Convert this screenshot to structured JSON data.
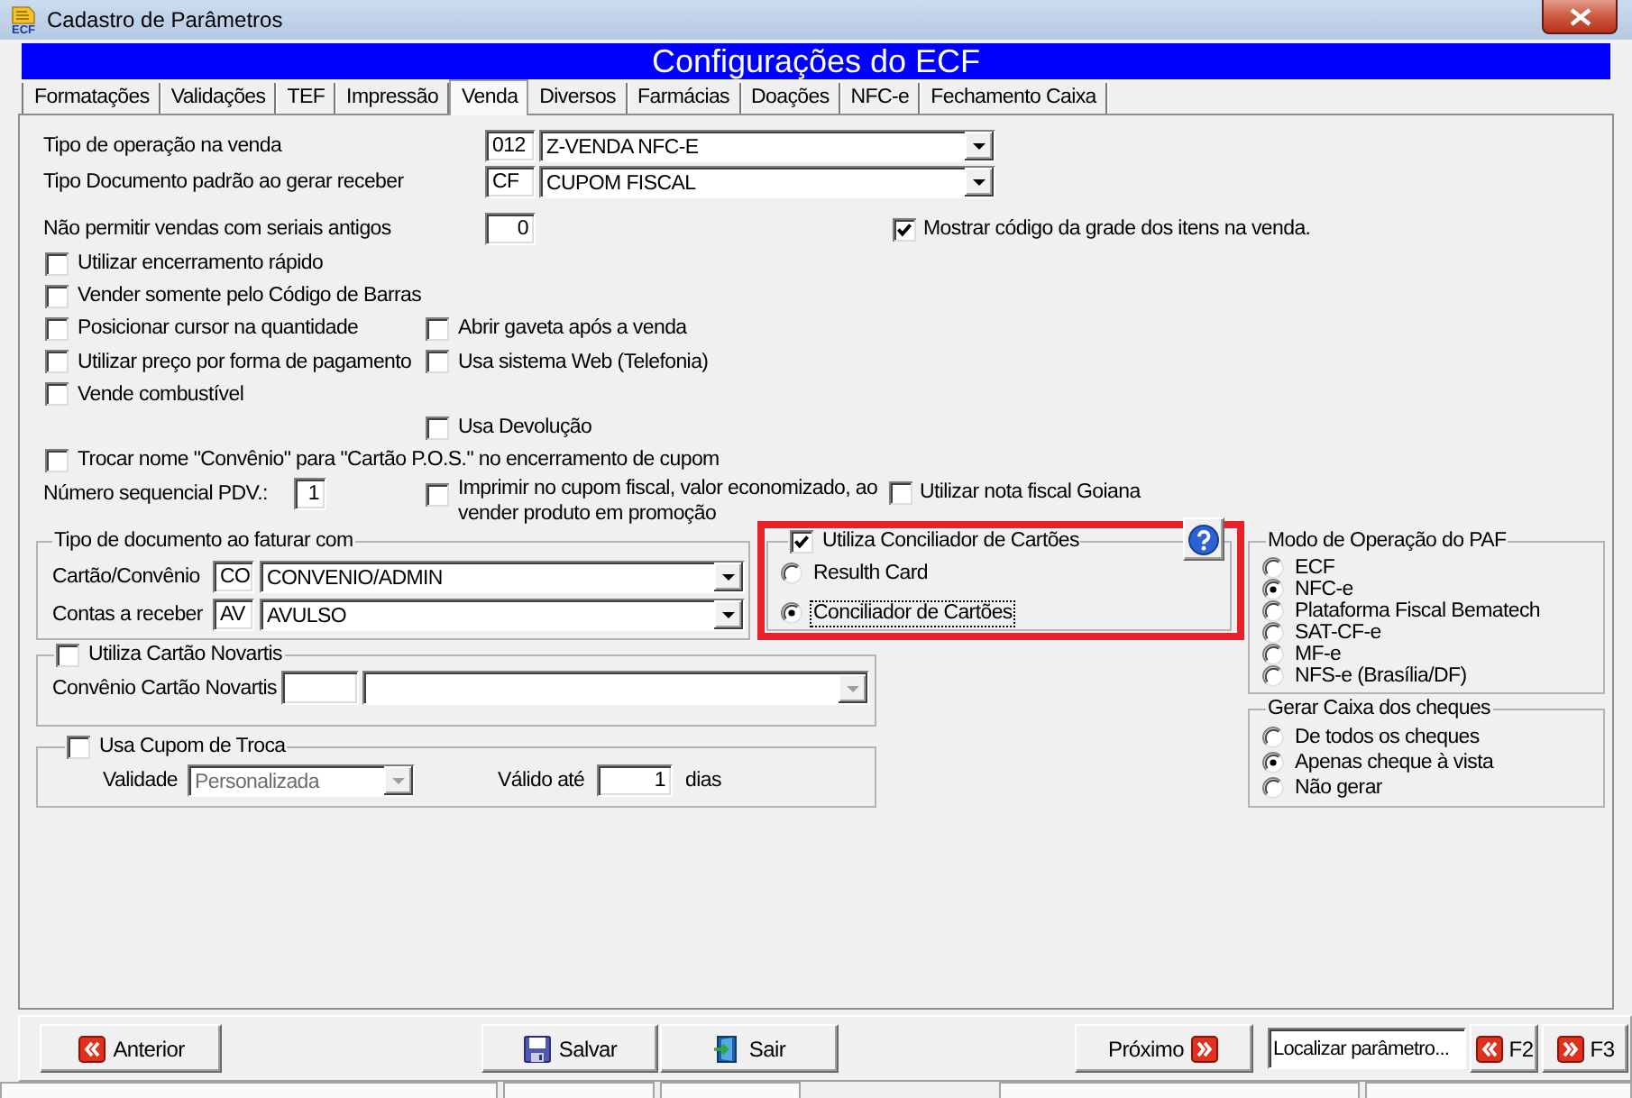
{
  "window": {
    "title": "Cadastro de Parâmetros",
    "icon_text": "ECF"
  },
  "header": {
    "title": "Configurações do ECF"
  },
  "tabs": [
    {
      "label": "Formatações",
      "selected": false
    },
    {
      "label": "Validações",
      "selected": false
    },
    {
      "label": "TEF",
      "selected": false
    },
    {
      "label": "Impressão",
      "selected": false
    },
    {
      "label": "Venda",
      "selected": true
    },
    {
      "label": "Diversos",
      "selected": false
    },
    {
      "label": "Farmácias",
      "selected": false
    },
    {
      "label": "Doações",
      "selected": false
    },
    {
      "label": "NFC-e",
      "selected": false
    },
    {
      "label": "Fechamento Caixa",
      "selected": false
    }
  ],
  "lookups": [
    {
      "label": "Tipo de operação na venda",
      "code": "012",
      "value": "Z-VENDA NFC-E"
    },
    {
      "label": "Tipo Documento padrão ao gerar receber",
      "code": "CF",
      "value": "CUPOM FISCAL"
    }
  ],
  "serials": {
    "label": "Não permitir vendas com seriais antigos",
    "value": "0"
  },
  "show_grid_code": {
    "label": "Mostrar código da grade dos itens na venda.",
    "checked": true
  },
  "option_rows": [
    {
      "left": {
        "label": "Utilizar encerramento rápido",
        "checked": false
      }
    },
    {
      "left": {
        "label": "Vender somente pelo Código de Barras",
        "checked": false
      }
    },
    {
      "left": {
        "label": "Posicionar cursor na quantidade",
        "checked": false
      },
      "right": {
        "label": "Abrir gaveta após a venda",
        "checked": false
      }
    },
    {
      "left": {
        "label": "Utilizar preço por forma de pagamento",
        "checked": false
      },
      "right": {
        "label": "Usa sistema Web (Telefonia)",
        "checked": false
      }
    },
    {
      "left": {
        "label": "Vende combustível",
        "checked": false
      }
    },
    {
      "right": {
        "label": "Usa Devolução",
        "checked": false
      }
    },
    {
      "left": {
        "label": "Trocar nome \"Convênio\" para \"Cartão P.O.S.\" no encerramento de cupom",
        "checked": false
      }
    }
  ],
  "pdv_sequence": {
    "label": "Número sequencial PDV.:",
    "value": "1"
  },
  "print_savings": {
    "label": "Imprimir no cupom fiscal, valor economizado, ao vender produto em promoção",
    "checked": false
  },
  "goiana": {
    "label": "Utilizar nota fiscal Goiana",
    "checked": false
  },
  "billing_doc": {
    "title": "Tipo de documento ao faturar com",
    "rows": [
      {
        "label": "Cartão/Convênio",
        "code": "CO",
        "value": "CONVENIO/ADMIN"
      },
      {
        "label": "Contas a receber",
        "code": "AV",
        "value": "AVULSO"
      }
    ]
  },
  "card_reconciler": {
    "label": "Utiliza Conciliador de Cartões",
    "checked": true,
    "options": [
      {
        "label": "Resulth Card",
        "selected": false,
        "focused": false
      },
      {
        "label": "Conciliador de Cartões",
        "selected": true,
        "focused": true
      }
    ]
  },
  "novartis": {
    "label": "Utiliza Cartão Novartis",
    "checked": false,
    "field_label": "Convênio Cartão Novartis",
    "combo": {
      "disabled": true
    }
  },
  "exchange_coupon": {
    "label": "Usa Cupom de Troca",
    "checked": false,
    "validity_label": "Validade",
    "validity": {
      "value": "Personalizada",
      "disabled": true
    },
    "valid_until_label": "Válido até",
    "valid_until": "1",
    "unit": "dias"
  },
  "paf_mode": {
    "title": "Modo de Operação do PAF",
    "options": [
      {
        "label": "ECF",
        "selected": false
      },
      {
        "label": "NFC-e",
        "selected": true
      },
      {
        "label": "Plataforma Fiscal Bematech",
        "selected": false
      },
      {
        "label": "SAT-CF-e",
        "selected": false
      },
      {
        "label": "MF-e",
        "selected": false
      },
      {
        "label": "NFS-e (Brasília/DF)",
        "selected": false
      }
    ]
  },
  "check_cash": {
    "title": "Gerar Caixa dos cheques",
    "options": [
      {
        "label": "De todos os cheques",
        "selected": false
      },
      {
        "label": "Apenas cheque à vista",
        "selected": true
      },
      {
        "label": "Não gerar",
        "selected": false
      }
    ]
  },
  "footer": {
    "buttons": [
      {
        "label": "Anterior",
        "kind": "previous"
      },
      {
        "label": "Salvar",
        "kind": "save"
      },
      {
        "label": "Sair",
        "kind": "exit"
      },
      {
        "label": "Próximo",
        "kind": "next"
      }
    ],
    "search": {
      "placeholder": "Localizar parâmetro..."
    },
    "shortcuts": [
      {
        "label": "F2",
        "kind": "previous"
      },
      {
        "label": "F3",
        "kind": "next"
      }
    ]
  }
}
